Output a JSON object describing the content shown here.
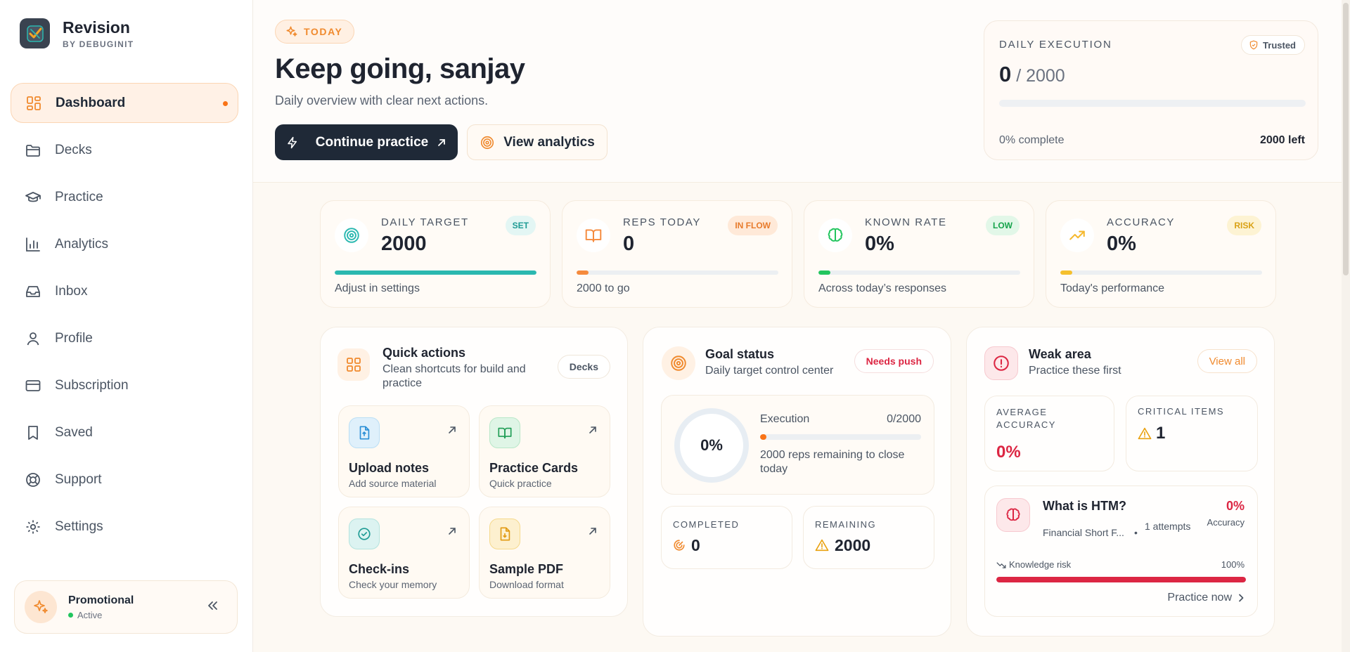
{
  "brand": {
    "title": "Revision",
    "subtitle": "BY DEBUGINIT"
  },
  "nav": [
    {
      "label": "Dashboard",
      "icon": "grid-icon",
      "active": true
    },
    {
      "label": "Decks",
      "icon": "folder-icon"
    },
    {
      "label": "Practice",
      "icon": "graduation-cap-icon"
    },
    {
      "label": "Analytics",
      "icon": "bar-chart-icon"
    },
    {
      "label": "Inbox",
      "icon": "inbox-icon"
    },
    {
      "label": "Profile",
      "icon": "user-icon"
    },
    {
      "label": "Subscription",
      "icon": "credit-card-icon"
    },
    {
      "label": "Saved",
      "icon": "bookmark-icon"
    },
    {
      "label": "Support",
      "icon": "life-buoy-icon"
    },
    {
      "label": "Settings",
      "icon": "gear-icon"
    }
  ],
  "promo": {
    "title": "Promotional",
    "status": "Active"
  },
  "hero": {
    "badge": "TODAY",
    "title": "Keep going, sanjay",
    "subtitle": "Daily overview with clear next actions.",
    "primary_button": "Continue practice",
    "secondary_button": "View analytics"
  },
  "execution": {
    "label": "DAILY EXECUTION",
    "trusted": "Trusted",
    "done": "0",
    "total": "2000",
    "progress": 0,
    "percent_text": "0% complete",
    "left_text": "2000 left"
  },
  "stats": [
    {
      "label": "DAILY TARGET",
      "value": "2000",
      "badge": "SET",
      "note": "Adjust in settings",
      "progress": 1.0,
      "color": "#2bb8b0",
      "badge_bg": "#e3f6f4",
      "badge_fg": "#1e9b94",
      "icon": "target-icon"
    },
    {
      "label": "REPS TODAY",
      "value": "0",
      "badge": "IN FLOW",
      "note": "2000 to go",
      "progress": 0.06,
      "color": "#f58a3d",
      "badge_bg": "#ffe9d8",
      "badge_fg": "#e77b2c",
      "icon": "book-open-icon"
    },
    {
      "label": "KNOWN RATE",
      "value": "0%",
      "badge": "LOW",
      "note": "Across today’s responses",
      "progress": 0.06,
      "color": "#22c55e",
      "badge_bg": "#e2f7e8",
      "badge_fg": "#15a34a",
      "icon": "brain-icon"
    },
    {
      "label": "ACCURACY",
      "value": "0%",
      "badge": "RISK",
      "note": "Today's performance",
      "progress": 0.06,
      "color": "#f5c02e",
      "badge_bg": "#fdf3d3",
      "badge_fg": "#d9a114",
      "icon": "trending-up-icon"
    }
  ],
  "quick_actions": {
    "title": "Quick actions",
    "subtitle": "Clean shortcuts for build and practice",
    "chip": "Decks",
    "items": [
      {
        "title": "Upload notes",
        "subtitle": "Add source material",
        "icon": "upload-file-icon"
      },
      {
        "title": "Practice Cards",
        "subtitle": "Quick practice",
        "icon": "book-icon"
      },
      {
        "title": "Check-ins",
        "subtitle": "Check your memory",
        "icon": "check-circle-icon"
      },
      {
        "title": "Sample PDF",
        "subtitle": "Download format",
        "icon": "download-file-icon"
      }
    ]
  },
  "goal": {
    "title": "Goal status",
    "subtitle": "Daily target control center",
    "chip": "Needs push",
    "ring_value": "0%",
    "progress": 0,
    "execution_label": "Execution",
    "execution_value": "0/2000",
    "remaining_text": "2000 reps remaining to close today",
    "completed_label": "COMPLETED",
    "completed_value": "0",
    "remaining_label": "REMAINING",
    "remaining_value": "2000"
  },
  "weak": {
    "title": "Weak area",
    "subtitle": "Practice these first",
    "chip": "View all",
    "avg_label": "AVERAGE ACCURACY",
    "avg_value": "0%",
    "critical_label": "CRITICAL ITEMS",
    "critical_value": "1",
    "item": {
      "title": "What is HTM?",
      "deck": "Financial Short F...",
      "attempts": "1 attempts",
      "accuracy": "0%",
      "accuracy_label": "Accuracy",
      "risk_label": "Knowledge risk",
      "risk_value": "100%",
      "risk": 1.0,
      "action": "Practice now"
    }
  }
}
